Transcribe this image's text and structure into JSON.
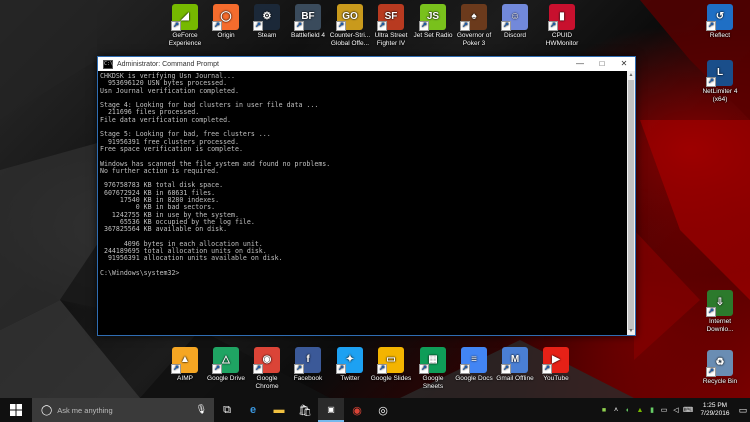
{
  "desktop_icons_top": [
    {
      "label": "GeForce\nExperience",
      "icon": "geforce-icon",
      "color": "#76b900",
      "glyph": "◢"
    },
    {
      "label": "Origin",
      "icon": "origin-icon",
      "color": "#f56c2d",
      "glyph": "◯"
    },
    {
      "label": "Steam",
      "icon": "steam-icon",
      "color": "#1b2838",
      "glyph": "⚙"
    },
    {
      "label": "Battlefield 4",
      "icon": "battlefield-4-icon",
      "color": "#3a4b5c",
      "glyph": "BF"
    },
    {
      "label": "Counter-Stri...\nGlobal Offe...",
      "icon": "csgo-icon",
      "color": "#c99a1c",
      "glyph": "GO"
    },
    {
      "label": "Ultra Street\nFighter IV",
      "icon": "street-fighter-icon",
      "color": "#b83a20",
      "glyph": "SF"
    },
    {
      "label": "Jet Set Radio",
      "icon": "jet-set-radio-icon",
      "color": "#79c11c",
      "glyph": "JS"
    },
    {
      "label": "Governor of\nPoker 3",
      "icon": "governor-of-poker-icon",
      "color": "#6b3a1c",
      "glyph": "♠"
    },
    {
      "label": "Discord",
      "icon": "discord-icon",
      "color": "#7289da",
      "glyph": "☺"
    },
    {
      "label": "CPUID\nHWMonitor",
      "icon": "hwmonitor-icon",
      "color": "#c8102e",
      "glyph": "▮"
    }
  ],
  "desktop_icons_right": [
    {
      "label": "Reflect",
      "icon": "reflect-icon",
      "color": "#1f6fc5",
      "glyph": "↺"
    },
    {
      "label": "NetLimiter 4\n(x64)",
      "icon": "netlimiter-icon",
      "color": "#1a4e8a",
      "glyph": "L"
    },
    {
      "label": "Internet\nDownlo...",
      "icon": "internet-download-manager-icon",
      "color": "#2c7a2c",
      "glyph": "⇩"
    },
    {
      "label": "Recycle Bin",
      "icon": "recycle-bin-icon",
      "color": "#6a8db3",
      "glyph": "♻"
    }
  ],
  "desktop_icons_bottom": [
    {
      "label": "AIMP",
      "icon": "aimp-icon",
      "color": "#f5a623",
      "glyph": "▲"
    },
    {
      "label": "Google Drive",
      "icon": "google-drive-icon",
      "color": "#1fa463",
      "glyph": "△"
    },
    {
      "label": "Google\nChrome",
      "icon": "google-chrome-icon",
      "color": "#db4437",
      "glyph": "◉"
    },
    {
      "label": "Facebook",
      "icon": "facebook-icon",
      "color": "#3b5998",
      "glyph": "f"
    },
    {
      "label": "Twitter",
      "icon": "twitter-icon",
      "color": "#1da1f2",
      "glyph": "✦"
    },
    {
      "label": "Google Slides",
      "icon": "google-slides-icon",
      "color": "#f4b400",
      "glyph": "▭"
    },
    {
      "label": "Google\nSheets",
      "icon": "google-sheets-icon",
      "color": "#0f9d58",
      "glyph": "▦"
    },
    {
      "label": "Google Docs",
      "icon": "google-docs-icon",
      "color": "#4285f4",
      "glyph": "≡"
    },
    {
      "label": "Gmail Offline",
      "icon": "gmail-offline-icon",
      "color": "#4a7fd4",
      "glyph": "M"
    },
    {
      "label": "YouTube",
      "icon": "youtube-icon",
      "color": "#e62117",
      "glyph": "▶"
    }
  ],
  "cmd_window": {
    "title": "Administrator: Command Prompt",
    "lines": [
      "CHKDSK is verifying Usn Journal...",
      "  953696120 USN bytes processed.",
      "Usn Journal verification completed.",
      "",
      "Stage 4: Looking for bad clusters in user file data ...",
      "  211696 files processed.",
      "File data verification completed.",
      "",
      "Stage 5: Looking for bad, free clusters ...",
      "  91956391 free clusters processed.",
      "Free space verification is complete.",
      "",
      "Windows has scanned the file system and found no problems.",
      "No further action is required.",
      "",
      " 976758783 KB total disk space.",
      " 607672924 KB in 68631 files.",
      "     17540 KB in 8280 indexes.",
      "         0 KB in bad sectors.",
      "   1242755 KB in use by the system.",
      "     65536 KB occupied by the log file.",
      " 367825564 KB available on disk.",
      "",
      "      4096 bytes in each allocation unit.",
      " 244189695 total allocation units on disk.",
      "  91956391 allocation units available on disk.",
      "",
      "C:\\Windows\\system32>"
    ]
  },
  "taskbar": {
    "search_placeholder": "Ask me anything",
    "time": "1:25 PM",
    "date": "7/29/2016"
  }
}
